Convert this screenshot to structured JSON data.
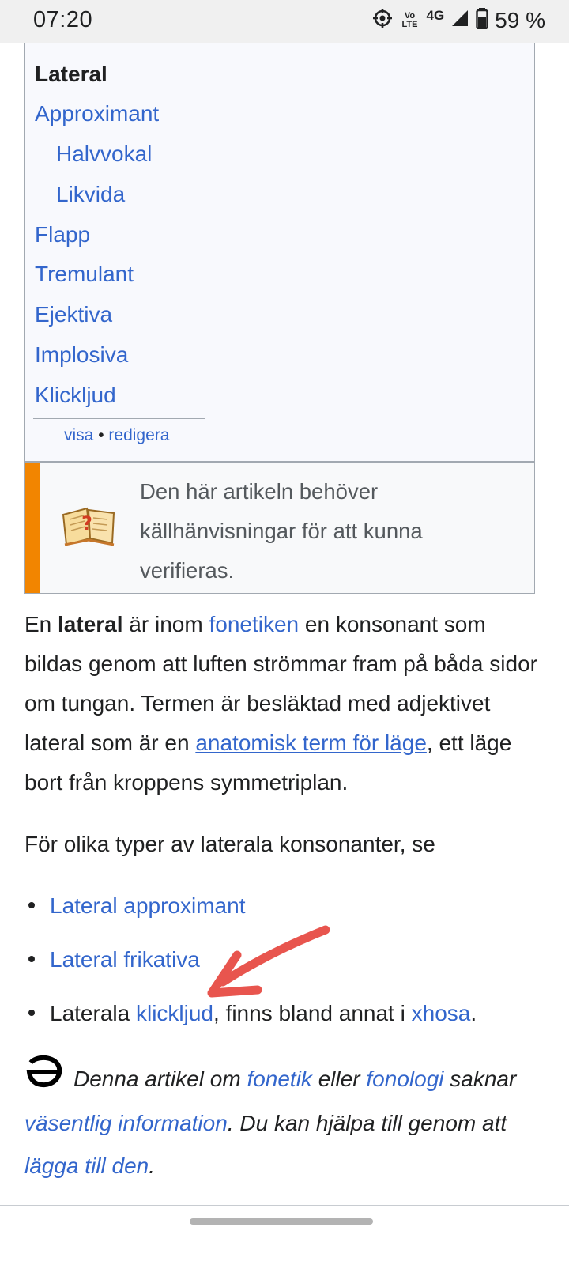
{
  "status_bar": {
    "time": "07:20",
    "volte": "Vo LTE",
    "network": "4G",
    "battery": "59 %"
  },
  "navbox": {
    "title": "Lateral",
    "items": [
      "Approximant",
      "Halvvokal",
      "Likvida",
      "Flapp",
      "Tremulant",
      "Ejektiva",
      "Implosiva",
      "Klickljud"
    ],
    "footer_view": "visa",
    "footer_sep": " • ",
    "footer_edit": "redigera"
  },
  "ambox": {
    "text": "Den här artikeln behöver källhänvisningar för att kunna verifieras."
  },
  "article": {
    "p1": {
      "t1": "En ",
      "bold": "lateral",
      "t2": " är inom ",
      "link1": "fonetiken",
      "t3": " en konsonant som bildas genom att luften strömmar fram på båda sidor om tungan. Termen är besläktad med adjektivet lateral som är en ",
      "link2": "anatomisk term för läge",
      "t4": ", ett läge bort från kroppens symmetriplan."
    },
    "p2": "För olika typer av laterala konsonanter, se",
    "list": {
      "item1": "Lateral approximant",
      "item2": "Lateral frikativa",
      "item3_t1": "Laterala ",
      "item3_link1": "klickljud",
      "item3_t2": ", finns bland annat i ",
      "item3_link2": "xhosa",
      "item3_t3": "."
    }
  },
  "stub": {
    "t1": "Denna artikel om ",
    "link1": "fonetik",
    "t2": " eller ",
    "link2": "fonologi",
    "t3": " saknar ",
    "link3": "väsentlig information",
    "t4": ". Du kan hjälpa till genom att ",
    "link4": "lägga till den",
    "t5": "."
  },
  "colors": {
    "link": "#3366cc",
    "ambox_bar": "#f28500",
    "annotation_arrow": "#e8554e",
    "navbox_bg": "#f8f9fd"
  },
  "icons": [
    "gps-icon",
    "volte-icon",
    "signal-icon",
    "battery-icon",
    "book-question-icon",
    "schwa-icon",
    "annotation-arrow"
  ]
}
